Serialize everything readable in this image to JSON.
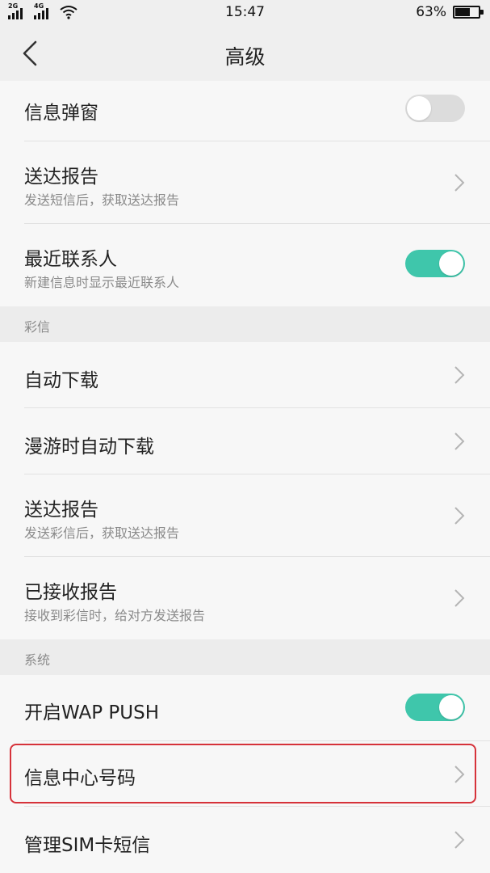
{
  "status_bar": {
    "sim1_network": "2G",
    "sim2_network": "4G",
    "time": "15:47",
    "battery_percent": "63%",
    "battery_level": 0.63
  },
  "header": {
    "title": "高级",
    "back_icon": "chevron-left-icon"
  },
  "sms": {
    "popup": {
      "title": "信息弹窗",
      "enabled": false
    },
    "delivery_report": {
      "title": "送达报告",
      "subtitle": "发送短信后，获取送达报告"
    },
    "recent_contacts": {
      "title": "最近联系人",
      "subtitle": "新建信息时显示最近联系人",
      "enabled": true
    }
  },
  "mms": {
    "section_label": "彩信",
    "auto_download": {
      "title": "自动下载"
    },
    "roaming_auto_download": {
      "title": "漫游时自动下载"
    },
    "delivery_report": {
      "title": "送达报告",
      "subtitle": "发送彩信后，获取送达报告"
    },
    "read_report": {
      "title": "已接收报告",
      "subtitle": "接收到彩信时，给对方发送报告"
    }
  },
  "system": {
    "section_label": "系统",
    "wap_push": {
      "title": "开启WAP PUSH",
      "enabled": true
    },
    "message_center": {
      "title": "信息中心号码"
    },
    "manage_sim": {
      "title": "管理SIM卡短信"
    }
  },
  "colors": {
    "toggle_on": "#3fc6ab",
    "toggle_off": "#dcdcdc",
    "highlight": "#d6323a"
  }
}
